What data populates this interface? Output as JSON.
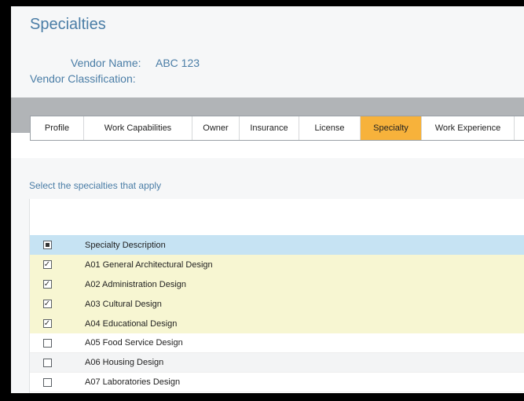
{
  "page": {
    "title": "Specialties"
  },
  "vendor": {
    "name_label": "Vendor Name:",
    "name_value": "ABC 123",
    "classification_label": "Vendor Classification:"
  },
  "tabs": [
    {
      "label": "Profile",
      "active": false
    },
    {
      "label": "Work Capabilities",
      "active": false
    },
    {
      "label": "Owner",
      "active": false
    },
    {
      "label": "Insurance",
      "active": false
    },
    {
      "label": "License",
      "active": false
    },
    {
      "label": "Specialty",
      "active": true
    },
    {
      "label": "Work Experience",
      "active": false
    }
  ],
  "instruction": "Select the specialties that apply",
  "table": {
    "header": "Specialty Description",
    "rows": [
      {
        "label": "A01 General Architectural Design",
        "checked": true
      },
      {
        "label": "A02 Administration Design",
        "checked": true
      },
      {
        "label": "A03 Cultural Design",
        "checked": true
      },
      {
        "label": "A04 Educational Design",
        "checked": true
      },
      {
        "label": "A05 Food Service Design",
        "checked": false
      },
      {
        "label": "A06 Housing Design",
        "checked": false
      },
      {
        "label": "A07 Laboratories Design",
        "checked": false
      }
    ]
  },
  "colors": {
    "title_blue": "#4a7da6",
    "active_tab": "#f7b23b",
    "header_row": "#c6e3f3",
    "selected_row": "#f7f6d2",
    "tab_band": "#b1b4b7"
  }
}
